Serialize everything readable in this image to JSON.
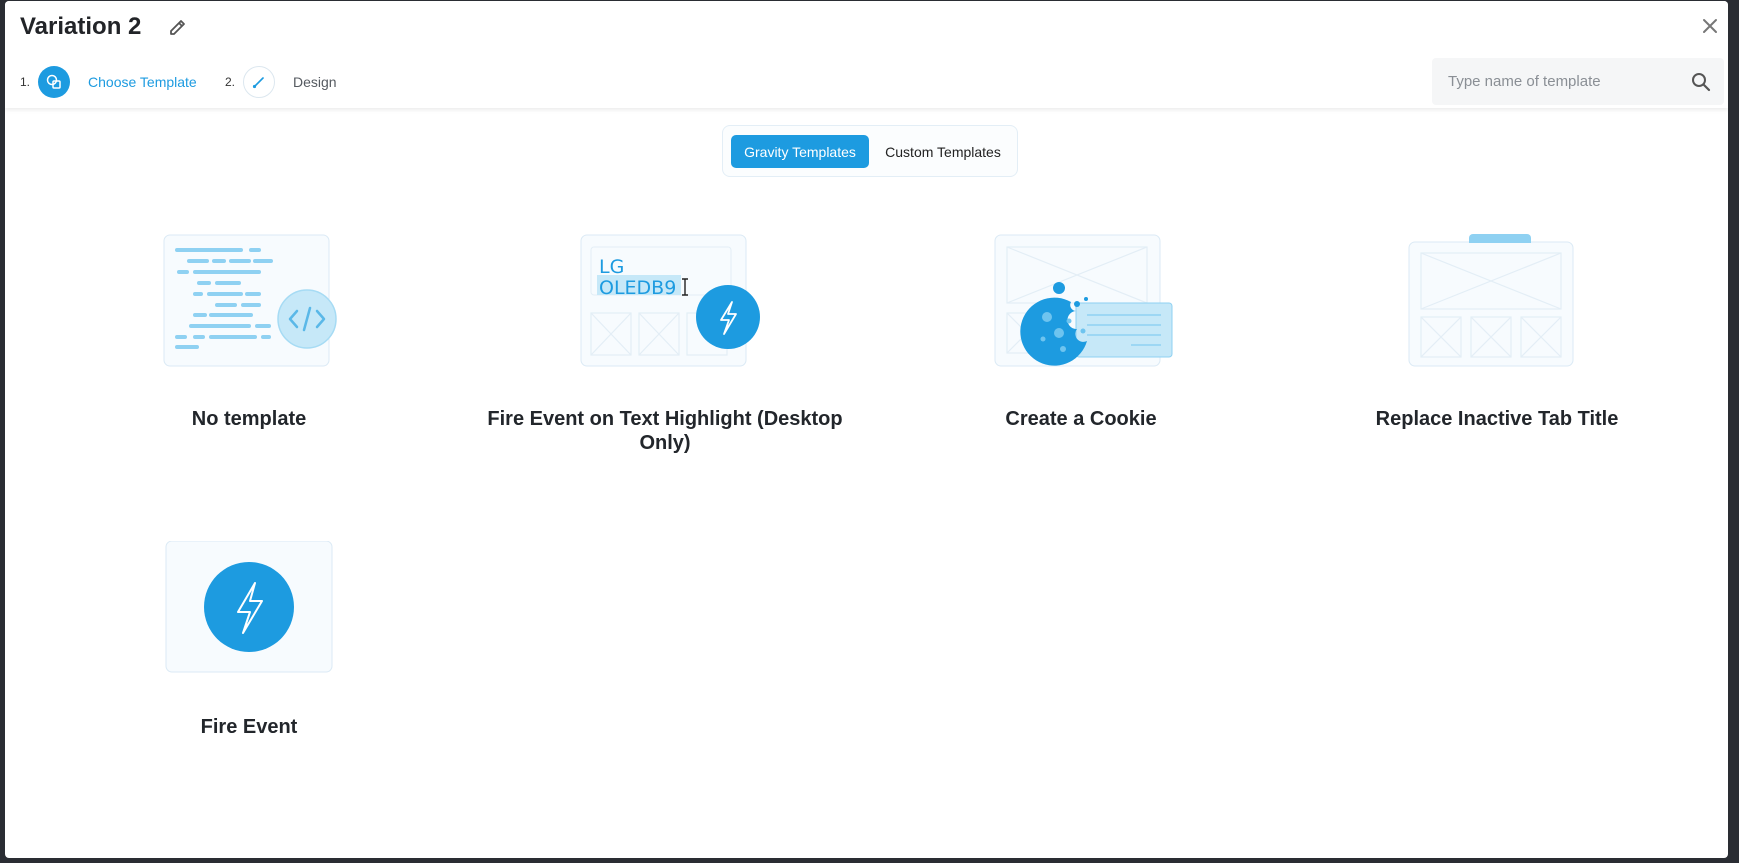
{
  "header": {
    "title": "Variation 2"
  },
  "steps": [
    {
      "number": "1.",
      "label": "Choose Template",
      "state": "active"
    },
    {
      "number": "2.",
      "label": "Design",
      "state": "inactive"
    }
  ],
  "search": {
    "placeholder": "Type name of template",
    "value": ""
  },
  "tabs": [
    {
      "label": "Gravity Templates",
      "selected": true
    },
    {
      "label": "Custom Templates",
      "selected": false
    }
  ],
  "templates": [
    {
      "title": "No template"
    },
    {
      "title": "Fire Event on Text Highlight (Desktop Only)",
      "preview_text_1": "LG",
      "preview_text_2": "OLEDB9"
    },
    {
      "title": "Create a Cookie"
    },
    {
      "title": "Replace Inactive Tab Title"
    },
    {
      "title": "Fire Event"
    }
  ],
  "colors": {
    "accent": "#1d9be0",
    "accent_light": "#8fd1f2",
    "thumb_bg": "#f7fbfe",
    "thumb_border": "#dbeaf5",
    "text_dark": "#22262b"
  },
  "icons": {
    "edit": "pencil-icon",
    "close": "close-icon",
    "search": "search-icon",
    "step1": "shapes-icon",
    "step2": "brush-icon"
  }
}
